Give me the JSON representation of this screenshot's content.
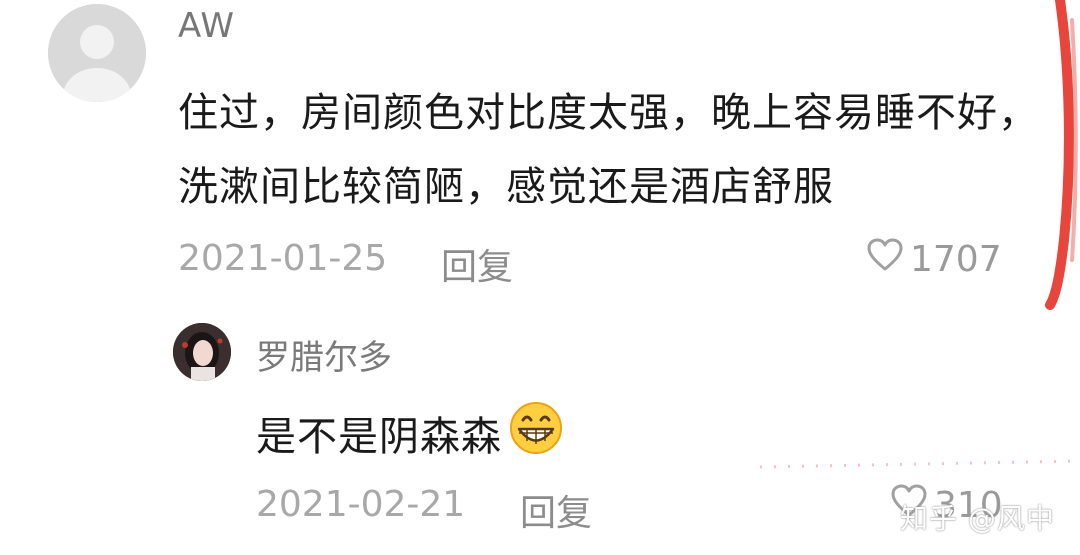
{
  "comment": {
    "username": "AW",
    "text": "住过，房间颜色对比度太强，晚上容易睡不好，洗漱间比较简陋，感觉还是酒店舒服",
    "date": "2021-01-25",
    "reply_label": "回复",
    "likes": "1707"
  },
  "reply": {
    "username": "罗腊尔多",
    "text": "是不是阴森森",
    "date": "2021-02-21",
    "reply_label": "回复",
    "likes": "310"
  },
  "watermark": "知乎 @风中",
  "icons": {
    "like": "heart-outline-icon",
    "emoji": "grinning-face-icon",
    "default_avatar": "default-user-avatar-icon"
  },
  "colors": {
    "accent_stroke": "#e8453c",
    "text_primary": "#1a1a1a",
    "text_secondary": "#a8a8a8"
  }
}
